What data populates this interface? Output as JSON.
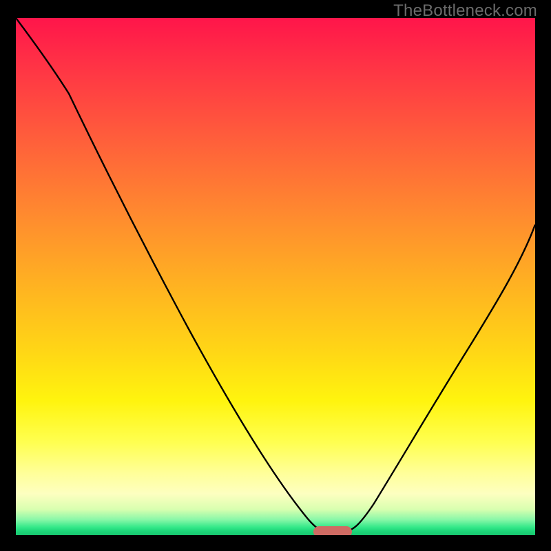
{
  "watermark": "TheBottleneck.com",
  "chart_data": {
    "type": "line",
    "title": "",
    "xlabel": "",
    "ylabel": "",
    "xlim": [
      0,
      100
    ],
    "ylim": [
      0,
      100
    ],
    "series": [
      {
        "name": "bottleneck-curve",
        "x": [
          0,
          5,
          10,
          15,
          20,
          25,
          30,
          35,
          40,
          45,
          50,
          55,
          57,
          60,
          63,
          65,
          70,
          75,
          80,
          85,
          90,
          95,
          100
        ],
        "values": [
          100,
          94,
          86,
          79,
          71,
          63,
          55,
          47,
          38,
          29,
          20,
          11,
          4,
          0,
          0,
          4,
          13,
          22,
          31,
          39,
          46,
          53,
          60
        ]
      }
    ],
    "marker": {
      "name": "optimal-range",
      "x_start": 57,
      "x_end": 63,
      "color": "#cf6b63"
    },
    "background_gradient": {
      "stops": [
        {
          "pos": 0.0,
          "color": "#ff154a"
        },
        {
          "pos": 0.5,
          "color": "#ffb321"
        },
        {
          "pos": 0.8,
          "color": "#ffff50"
        },
        {
          "pos": 0.98,
          "color": "#37e98a"
        },
        {
          "pos": 1.0,
          "color": "#17c46e"
        }
      ]
    }
  }
}
